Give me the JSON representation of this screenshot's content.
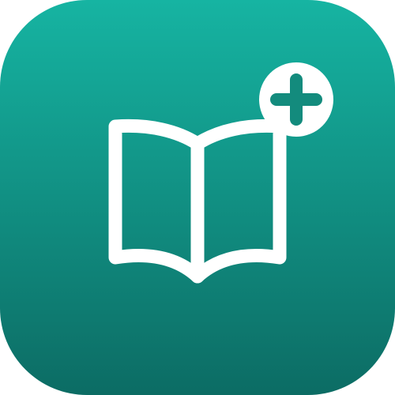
{
  "icon": {
    "name": "add-book-app-icon",
    "glyph": "open-book-icon",
    "badge": "plus-icon",
    "colors": {
      "gradient_top": "#16b4a2",
      "gradient_bottom": "#0c6c64",
      "glyph": "#ffffff",
      "plus": "#138b7d"
    }
  }
}
